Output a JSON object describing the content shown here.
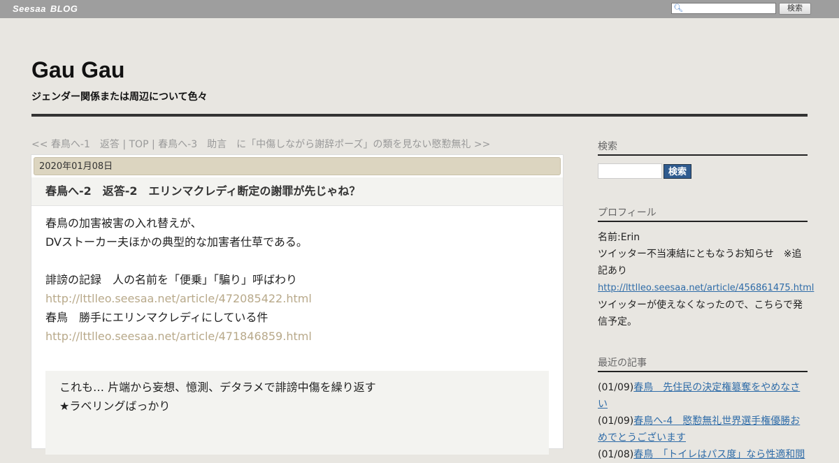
{
  "topbar": {
    "brand_1": "Seesaa",
    "brand_2": "BLOG",
    "search_button": "検索",
    "search_value": ""
  },
  "header": {
    "title": "Gau Gau",
    "description": "ジェンダー関係または周辺について色々"
  },
  "nav": {
    "prev": "<< 春鳥へ-1　返答",
    "sep1": " | ",
    "top": "TOP",
    "sep2": " | ",
    "next": "春鳥へ-3　助言　に「中傷しながら謝辞ポーズ」の類を見ない愍懃無礼 >>"
  },
  "article": {
    "date": "2020年01月08日",
    "title": "春鳥へ-2　返答-2　エリンマクレディ断定の謝罪が先じゃね？",
    "lines": [
      {
        "text": "春鳥の加害被害の入れ替えが、",
        "link": false
      },
      {
        "text": "DVストーカー夫ほかの典型的な加害者仕草である。",
        "link": false
      },
      {
        "text": "",
        "link": false
      },
      {
        "text": "誹謗の記録　人の名前を「便乗」「騙り」呼ばわり",
        "link": false
      },
      {
        "text": "http://lttlleo.seesaa.net/article/472085422.html",
        "link": true
      },
      {
        "text": "春鳥　勝手にエリンマクレディにしている件",
        "link": false
      },
      {
        "text": "http://lttlleo.seesaa.net/article/471846859.html",
        "link": true
      }
    ],
    "quote_lines": [
      "これも… 片端から妄想、憶測、デタラメで誹謗中傷を繰り返す",
      "★ラベリングばっかり"
    ]
  },
  "sidebar": {
    "search": {
      "heading": "検索",
      "button": "検索",
      "value": ""
    },
    "profile": {
      "heading": "プロフィール",
      "name": "名前:Erin",
      "notice": "ツイッター不当凍結にともなうお知らせ　※追記あり",
      "link": "http://lttlleo.seesaa.net/article/456861475.html",
      "note": "ツイッターが使えなくなったので、こちらで発信予定。"
    },
    "recent": {
      "heading": "最近の記事",
      "items": [
        {
          "date": "(01/09)",
          "title": "春鳥　先住民の決定権簒奪をやめなさい"
        },
        {
          "date": "(01/09)",
          "title": "春鳥へ-4　愍懃無礼世界選手権優勝おめでとうございます"
        },
        {
          "date": "(01/08)",
          "title": "春鳥　「トイレはパス度」なら性適和閲"
        }
      ]
    }
  },
  "colors": {
    "topbar": "#9e9e9e",
    "background": "#e8e6e1",
    "date_bar": "#dcd5c0",
    "link_body": "#b8a98a",
    "link_sidebar": "#2f6ca8",
    "sidebar_button": "#2f5b8f"
  }
}
